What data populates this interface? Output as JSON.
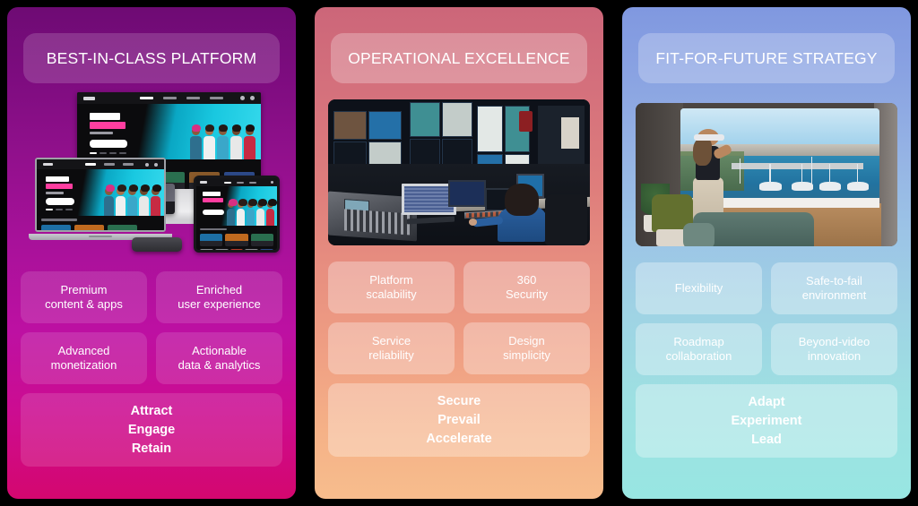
{
  "background_color": "#000000",
  "columns": [
    {
      "id": "best-in-class-platform",
      "header": "BEST-IN-CLASS PLATFORM",
      "gradient_from": "#6e0b74",
      "gradient_to": "#d4076f",
      "media": {
        "alt": "Multi-device streaming platform mockup showing TV, laptop, tablet and set-top box displaying a show banner",
        "type": "device-mockup"
      },
      "chips": [
        "Premium\ncontent & apps",
        "Enriched\nuser experience",
        "Advanced\nmonetization",
        "Actionable\ndata & analytics"
      ],
      "footer": "Attract\nEngage\nRetain"
    },
    {
      "id": "operational-excellence",
      "header": "OPERATIONAL EXCELLENCE",
      "gradient_from": "#cc6679",
      "gradient_to": "#f7bd8d",
      "media": {
        "alt": "Broadcast control room with an operator at a mixing console facing a wall of monitors",
        "type": "photo"
      },
      "chips": [
        "Platform\nscalability",
        "360\nSecurity",
        "Service\nreliability",
        "Design\nsimplicity"
      ],
      "footer": "Secure\nPrevail\nAccelerate"
    },
    {
      "id": "fit-for-future-strategy",
      "header": "FIT-FOR-FUTURE STRATEGY",
      "gradient_from": "#8098e0",
      "gradient_to": "#98e6e2",
      "media": {
        "alt": "Woman wearing a VR headset in a living room immersed in a marina harbour scene on a curved wraparound screen",
        "type": "photo"
      },
      "chips": [
        "Flexibility",
        "Safe-to-fail\nenvironment",
        "Roadmap\ncollaboration",
        "Beyond-video\ninnovation"
      ],
      "footer": "Adapt\nExperiment\nLead"
    }
  ]
}
